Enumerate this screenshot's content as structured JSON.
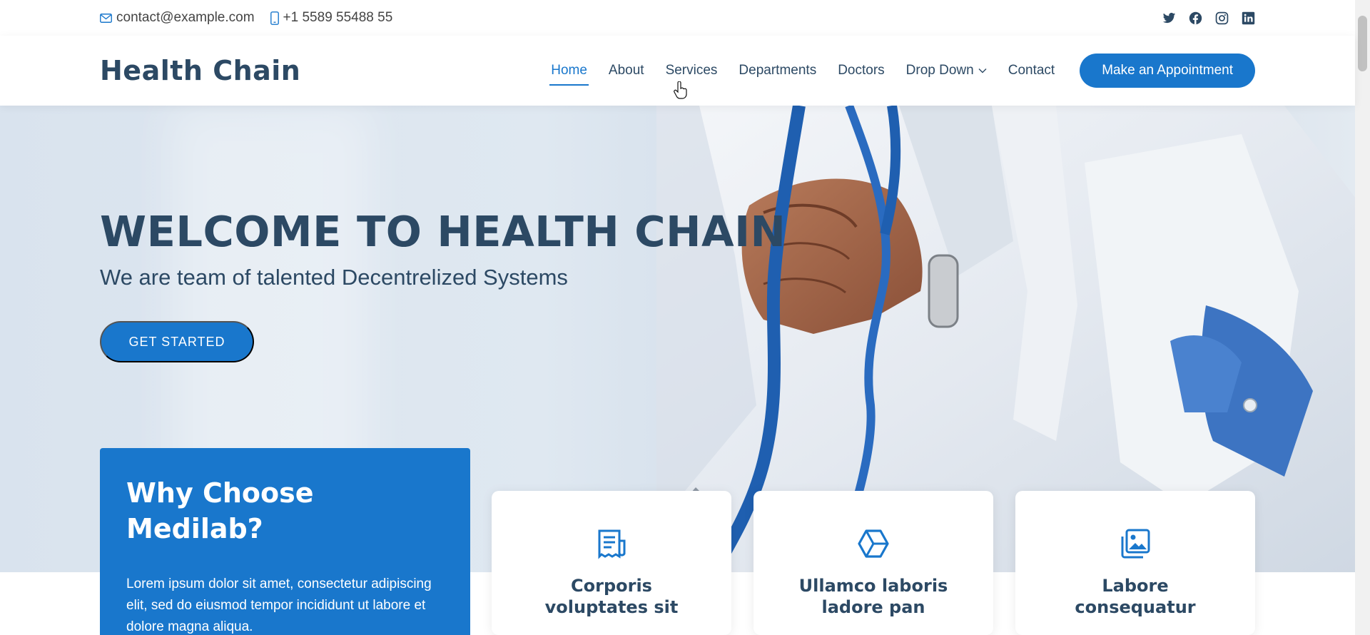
{
  "topbar": {
    "email": "contact@example.com",
    "phone": "+1 5589 55488 55",
    "social": [
      "twitter-icon",
      "facebook-icon",
      "instagram-icon",
      "linkedin-icon"
    ]
  },
  "header": {
    "logo": "Health Chain",
    "nav": [
      "Home",
      "About",
      "Services",
      "Departments",
      "Doctors",
      "Drop Down",
      "Contact"
    ],
    "active": "Home",
    "cta": "Make an Appointment"
  },
  "hero": {
    "title": "WELCOME TO HEALTH CHAIN",
    "subtitle": "We are team of talented Decentrelized Systems",
    "button": "GET STARTED"
  },
  "why": {
    "title": "Why Choose Medilab?",
    "text": "Lorem ipsum dolor sit amet, consectetur adipiscing elit, sed do eiusmod tempor incididunt ut labore et dolore magna aliqua."
  },
  "cards": [
    {
      "icon": "receipt-icon",
      "title": "Corporis voluptates sit"
    },
    {
      "icon": "cube-icon",
      "title": "Ullamco laboris ladore pan"
    },
    {
      "icon": "images-icon",
      "title": "Labore consequatur"
    }
  ],
  "colors": {
    "accent": "#1977cc",
    "heading": "#2c4964"
  }
}
